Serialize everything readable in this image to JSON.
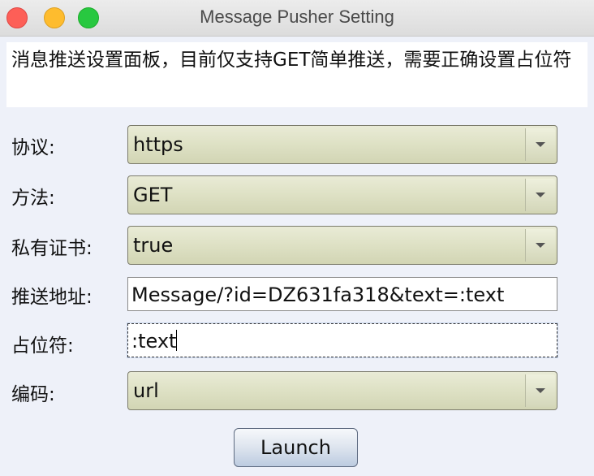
{
  "window": {
    "title": "Message Pusher Setting"
  },
  "description": "消息推送设置面板，目前仅支持GET简单推送，需要正确设置占位符",
  "form": {
    "protocol": {
      "label": "协议:",
      "value": "https"
    },
    "method": {
      "label": "方法:",
      "value": "GET"
    },
    "private_cert": {
      "label": "私有证书:",
      "value": "true"
    },
    "push_url": {
      "label": "推送地址:",
      "value": "Message/?id=DZ631fa318&text=:text"
    },
    "placeholder": {
      "label": "占位符:",
      "value": ":text"
    },
    "encoding": {
      "label": "编码:",
      "value": "url"
    }
  },
  "actions": {
    "launch_label": "Launch"
  }
}
